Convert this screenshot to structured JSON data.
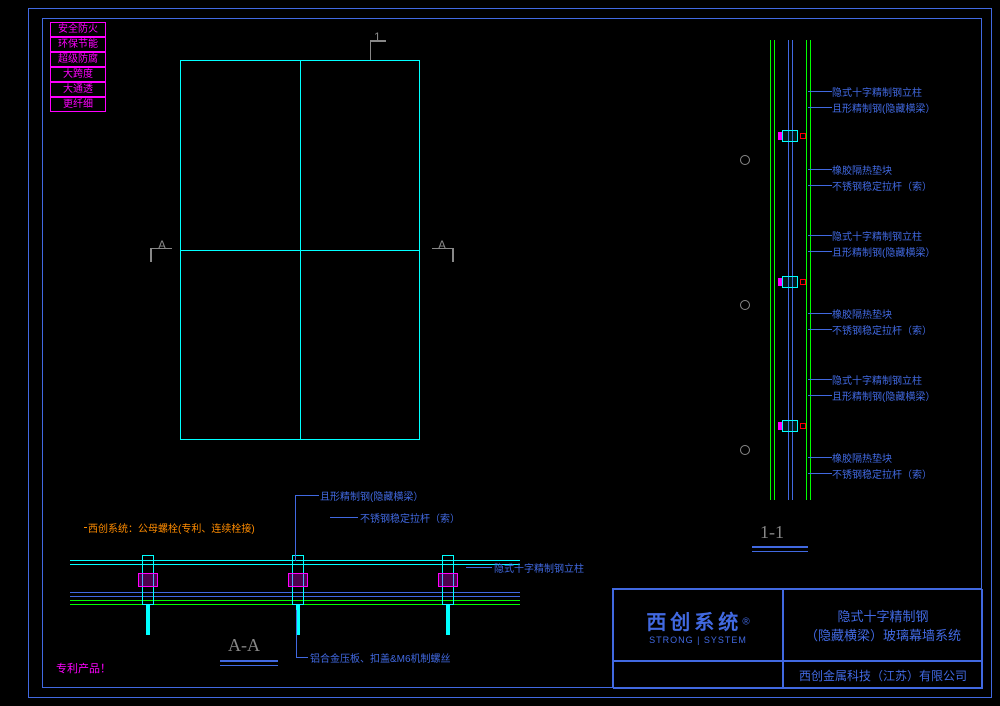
{
  "tags": [
    "安全防火",
    "环保节能",
    "超级防腐",
    "大跨度",
    "大通透",
    "更纤细"
  ],
  "section_markers": {
    "top_marker": "1",
    "side_marker": "A"
  },
  "section_labels": {
    "aa": "A-A",
    "one_one": "1-1"
  },
  "annotations": {
    "hidden_cross_column": "隐式十字精制钢立柱",
    "q_shape_beam": "且形精制钢(隐藏横梁）",
    "rubber_block": "橡胶隔热垫块",
    "steel_rod": "不锈钢稳定拉杆（索）",
    "xichuang_system": "西创系统：公母螺栓(专利、连续栓接)",
    "aluminum_plate": "铝合金压板、扣盖&M6机制螺丝"
  },
  "patent_label": "专利产品！",
  "title_block": {
    "logo_main": "西创系统",
    "logo_sub": "STRONG | SYSTEM",
    "reg": "®",
    "product_line1": "隐式十字精制钢",
    "product_line2": "（隐藏横梁）玻璃幕墙系统",
    "company": "西创金属科技（江苏）有限公司"
  }
}
